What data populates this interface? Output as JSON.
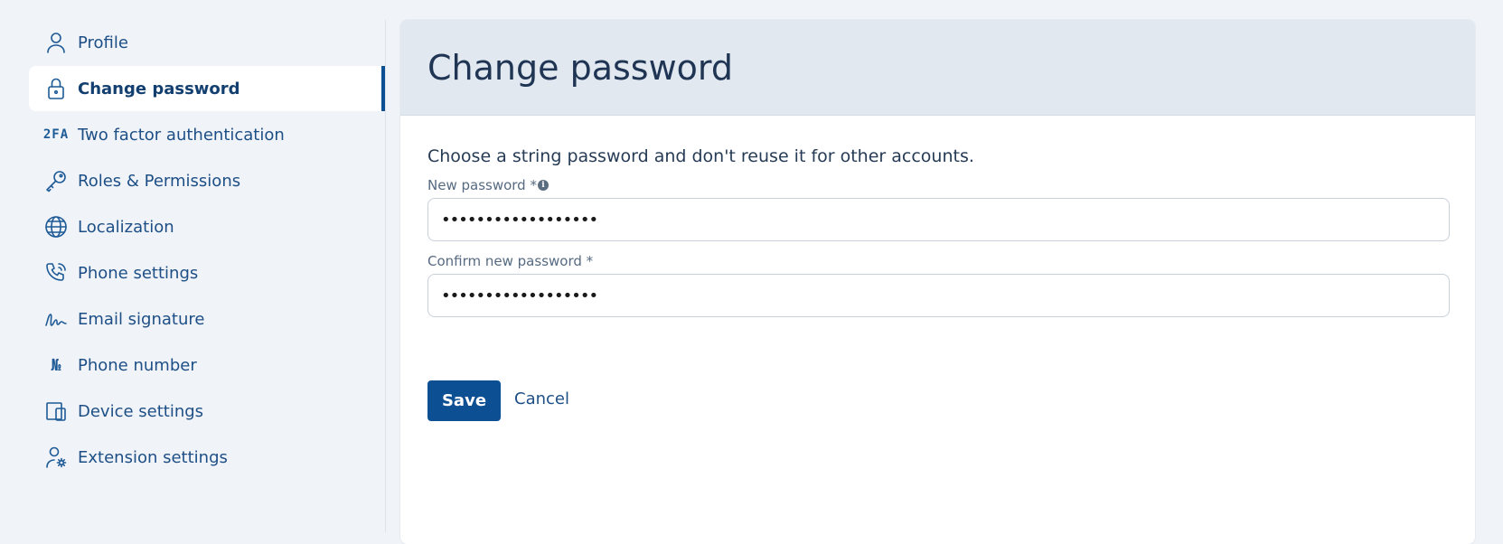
{
  "sidebar": {
    "items": [
      {
        "label": "Profile",
        "icon": "user-icon"
      },
      {
        "label": "Change password",
        "icon": "lock-icon",
        "active": true
      },
      {
        "label": "Two factor authentication",
        "icon": "2fa-icon",
        "icon_text": "2FA"
      },
      {
        "label": "Roles & Permissions",
        "icon": "key-icon"
      },
      {
        "label": "Localization",
        "icon": "globe-icon"
      },
      {
        "label": "Phone settings",
        "icon": "phone-icon"
      },
      {
        "label": "Email signature",
        "icon": "signature-icon"
      },
      {
        "label": "Phone number",
        "icon": "numero-icon",
        "icon_text": "№"
      },
      {
        "label": "Device settings",
        "icon": "device-icon"
      },
      {
        "label": "Extension settings",
        "icon": "user-gear-icon"
      }
    ]
  },
  "main": {
    "title": "Change password",
    "intro": "Choose a string password and don't reuse it for other accounts.",
    "new_password": {
      "label": "New password *",
      "value": "••••••••••••••••••"
    },
    "confirm_password": {
      "label": "Confirm new password *",
      "value": "••••••••••••••••••"
    },
    "save_label": "Save",
    "cancel_label": "Cancel"
  },
  "colors": {
    "accent": "#0d4f93",
    "background": "#f0f3f8",
    "header_bg": "#e1e8f0"
  }
}
